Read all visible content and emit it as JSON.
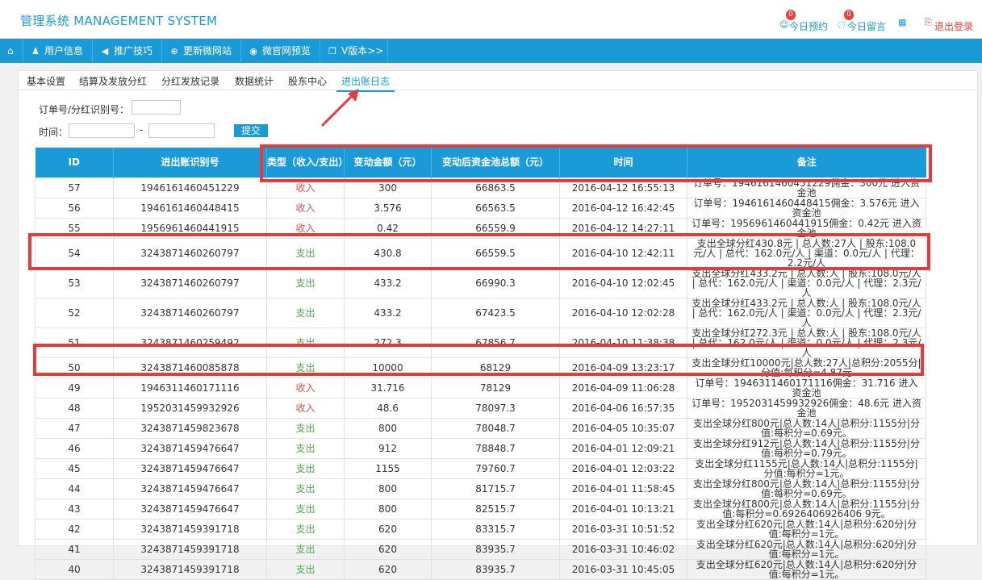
{
  "app_title": "管理系统 MANAGEMENT SYSTEM",
  "header_tools": {
    "appointment_label": "今日预约",
    "appointment_count": "0",
    "messages_label": "今日留言",
    "messages_count": "0",
    "logout_label": "退出登录"
  },
  "nav": [
    {
      "label": "用户信息"
    },
    {
      "label": "推广技巧"
    },
    {
      "label": "更新微网站"
    },
    {
      "label": "微官网预览"
    },
    {
      "label": "V版本>>"
    }
  ],
  "tabs": [
    "基本设置",
    "结算及发放分红",
    "分红发放记录",
    "数据统计",
    "股东中心",
    "进出账日志"
  ],
  "search": {
    "order_label": "订单号/分红识别号：",
    "time_label": "时间：",
    "time_sep": "-",
    "submit_label": "提交"
  },
  "table": {
    "headers": [
      "ID",
      "进出账识别号",
      "类型（收入/支出）",
      "变动金额（元）",
      "变动后资金池总额（元）",
      "时间",
      "备注"
    ],
    "rows": [
      [
        "57",
        "1946161460451229",
        "收入",
        "300",
        "66863.5",
        "2016-04-12 16:55:13",
        "订单号：1946161460451229佣金：300元 进入资金池"
      ],
      [
        "56",
        "1946161460448415",
        "收入",
        "3.576",
        "66563.5",
        "2016-04-12 16:42:45",
        "订单号：1946161460448415佣金：3.576元 进入资金池"
      ],
      [
        "55",
        "1956961460441915",
        "收入",
        "0.42",
        "66559.9",
        "2016-04-12 14:27:11",
        "订单号：1956961460441915佣金：0.42元 进入资金池"
      ],
      [
        "54",
        "3243871460260797",
        "支出",
        "430.8",
        "66559.5",
        "2016-04-10 12:42:11",
        "支出全球分红430.8元 | 总人数:27人 | 股东:108.0元/人 | 总代：162.0元/人 | 渠道：0.0元/人 | 代理：2.2元/人"
      ],
      [
        "53",
        "3243871460260797",
        "支出",
        "433.2",
        "66990.3",
        "2016-04-10 12:02:45",
        "支出全球分红433.2元 | 总人数:人 | 股东:108.0元/人 | 总代：162.0元/人 | 渠道：0.0元/人 | 代理：2.3元/人"
      ],
      [
        "52",
        "3243871460260797",
        "支出",
        "433.2",
        "67423.5",
        "2016-04-10 12:02:28",
        "支出全球分红433.2元 | 总人数:人 | 股东:108.0元/人 | 总代：162.0元/人 | 渠道：0.0元/人 | 代理：2.3元/人"
      ],
      [
        "51",
        "3243871460259492",
        "支出",
        "272.3",
        "67856.7",
        "2016-04-10 11:38:38",
        "支出全球分红272.3元 | 总人数:人 | 股东:108.0元/人 | 总代：162.0元/人 | 渠道：0.0元/人 | 代理：2.3元/人"
      ],
      [
        "50",
        "3243871460085878",
        "支出",
        "10000",
        "68129",
        "2016-04-09 13:23:17",
        "支出全球分红10000元|总人数:27人|总积分:2055分|分值:每积分=4.87元"
      ],
      [
        "49",
        "1946311460171116",
        "收入",
        "31.716",
        "78129",
        "2016-04-09 11:06:28",
        "订单号：1946311460171116佣金：31.716 进入资金池"
      ],
      [
        "48",
        "1952031459932926",
        "收入",
        "48.6",
        "78097.3",
        "2016-04-06 16:57:35",
        "订单号：1952031459932926佣金：48.6元 进入资金池"
      ],
      [
        "47",
        "3243871459823678",
        "支出",
        "800",
        "78048.7",
        "2016-04-05 10:35:07",
        "支出全球分红800元|总人数:14人|总积分:1155分|分值:每积分=0.69元。"
      ],
      [
        "46",
        "3243871459476647",
        "支出",
        "912",
        "78848.7",
        "2016-04-01 12:09:21",
        "支出全球分红912元|总人数:14人|总积分:1155分|分值:每积分=0.79元。"
      ],
      [
        "45",
        "3243871459476647",
        "支出",
        "1155",
        "79760.7",
        "2016-04-01 12:03:22",
        "支出全球分红1155元|总人数:14人|总积分:1155分|分值:每积分=1元。"
      ],
      [
        "44",
        "3243871459476647",
        "支出",
        "800",
        "81715.7",
        "2016-04-01 11:58:45",
        "支出全球分红800元|总人数:14人|总积分:1155分|分值:每积分=0.69元。"
      ],
      [
        "43",
        "3243871459476647",
        "支出",
        "800",
        "82515.7",
        "2016-04-01 10:13:21",
        "支出全球分红800元|总人数:14人|总积分:1155分|分值:每积分=0.6926406926406 9元。"
      ],
      [
        "42",
        "3243871459391718",
        "支出",
        "620",
        "83315.7",
        "2016-03-31 10:51:52",
        "支出全球分红620元|总人数:14人|总积分:620分|分值:每积分=1元。"
      ],
      [
        "41",
        "3243871459391718",
        "支出",
        "620",
        "83935.7",
        "2016-03-31 10:46:02",
        "支出全球分红620元|总人数:14人|总积分:620分|分值:每积分=1元。"
      ],
      [
        "40",
        "3243871459391718",
        "支出",
        "620",
        "83935.7",
        "2016-03-31 10:45:05",
        "支出全球分红620元|总人数:14人|总积分:620分|分值:每积分=1元。"
      ]
    ]
  },
  "colors": {
    "primary": "#1a9bd7",
    "income": "#d9534f",
    "expense": "#4cae4c",
    "highlight": "#e53b3b"
  }
}
